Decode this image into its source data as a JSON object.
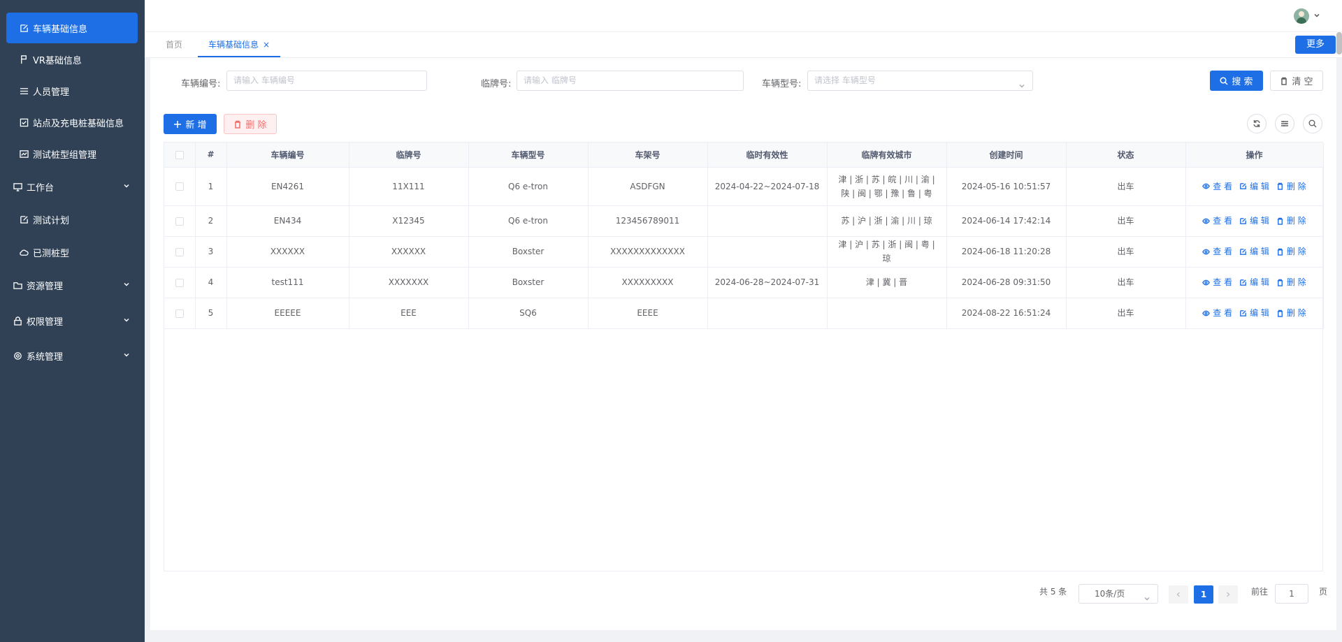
{
  "sidebar": {
    "items": [
      {
        "label": "车辆基础信息",
        "icon": "edit-icon",
        "active": true
      },
      {
        "label": "VR基础信息",
        "icon": "flag-icon"
      },
      {
        "label": "人员管理",
        "icon": "list-icon"
      },
      {
        "label": "站点及充电桩基础信息",
        "icon": "checkbox-icon"
      },
      {
        "label": "测试桩型组管理",
        "icon": "monitor-card-icon"
      },
      {
        "label": "工作台",
        "icon": "monitor-icon",
        "expandable": true
      },
      {
        "label": "测试计划",
        "icon": "edit-icon"
      },
      {
        "label": "已测桩型",
        "icon": "cloud-icon"
      },
      {
        "label": "资源管理",
        "icon": "folder-icon",
        "expandable": true
      },
      {
        "label": "权限管理",
        "icon": "lock-icon",
        "expandable": true
      },
      {
        "label": "系统管理",
        "icon": "gear-icon",
        "expandable": true
      }
    ]
  },
  "tabs": [
    {
      "label": "首页"
    },
    {
      "label": "车辆基础信息",
      "close": "×",
      "active": true
    }
  ],
  "more_button": "更多",
  "filters": {
    "vehicle_no_label": "车辆编号:",
    "vehicle_no_placeholder": "请输入 车辆编号",
    "plate_label": "临牌号:",
    "plate_placeholder": "请输入 临牌号",
    "model_label": "车辆型号:",
    "model_placeholder": "请选择 车辆型号",
    "search_button": "搜 索",
    "clear_button": "清 空"
  },
  "toolbar": {
    "add_button": "新 增",
    "delete_button": "删 除"
  },
  "table": {
    "columns": [
      "#",
      "车辆编号",
      "临牌号",
      "车辆型号",
      "车架号",
      "临时有效性",
      "临牌有效城市",
      "创建时间",
      "状态",
      "操作"
    ],
    "rows": [
      {
        "idx": "1",
        "vehicle_no": "EN4261",
        "plate": "11X111",
        "model": "Q6 e-tron",
        "vin": "ASDFGN",
        "validity": "2024-04-22~2024-07-18",
        "cities": "津 | 浙 | 苏 | 皖 | 川 | 渝 | 陕 | 闽 | 鄂 | 豫 | 鲁 | 粤",
        "created": "2024-05-16 10:51:57",
        "status": "出车"
      },
      {
        "idx": "2",
        "vehicle_no": "EN434",
        "plate": "X12345",
        "model": "Q6 e-tron",
        "vin": "123456789011",
        "validity": "",
        "cities": "苏 | 沪 | 浙 | 渝 | 川 | 琼",
        "created": "2024-06-14 17:42:14",
        "status": "出车"
      },
      {
        "idx": "3",
        "vehicle_no": "XXXXXX",
        "plate": "XXXXXX",
        "model": "Boxster",
        "vin": "XXXXXXXXXXXXX",
        "validity": "",
        "cities": "津 | 沪 | 苏 | 浙 | 闽 | 粤 | 琼",
        "created": "2024-06-18 11:20:28",
        "status": "出车"
      },
      {
        "idx": "4",
        "vehicle_no": "test111",
        "plate": "XXXXXXX",
        "model": "Boxster",
        "vin": "XXXXXXXXX",
        "validity": "2024-06-28~2024-07-31",
        "cities": "津 | 冀 | 晋",
        "created": "2024-06-28 09:31:50",
        "status": "出车"
      },
      {
        "idx": "5",
        "vehicle_no": "EEEEE",
        "plate": "EEE",
        "model": "SQ6",
        "vin": "EEEE",
        "validity": "",
        "cities": "",
        "created": "2024-08-22 16:51:24",
        "status": "出车"
      }
    ],
    "actions": {
      "view": "查 看",
      "edit": "编 辑",
      "delete": "删 除"
    }
  },
  "pagination": {
    "total": "共 5 条",
    "page_size": "10条/页",
    "current_page": "1",
    "goto_label": "前往",
    "goto_value": "1",
    "page_suffix": "页"
  },
  "colors": {
    "primary": "#1e6fe6",
    "sidebar_bg": "#304156",
    "danger": "#f56c6c"
  }
}
